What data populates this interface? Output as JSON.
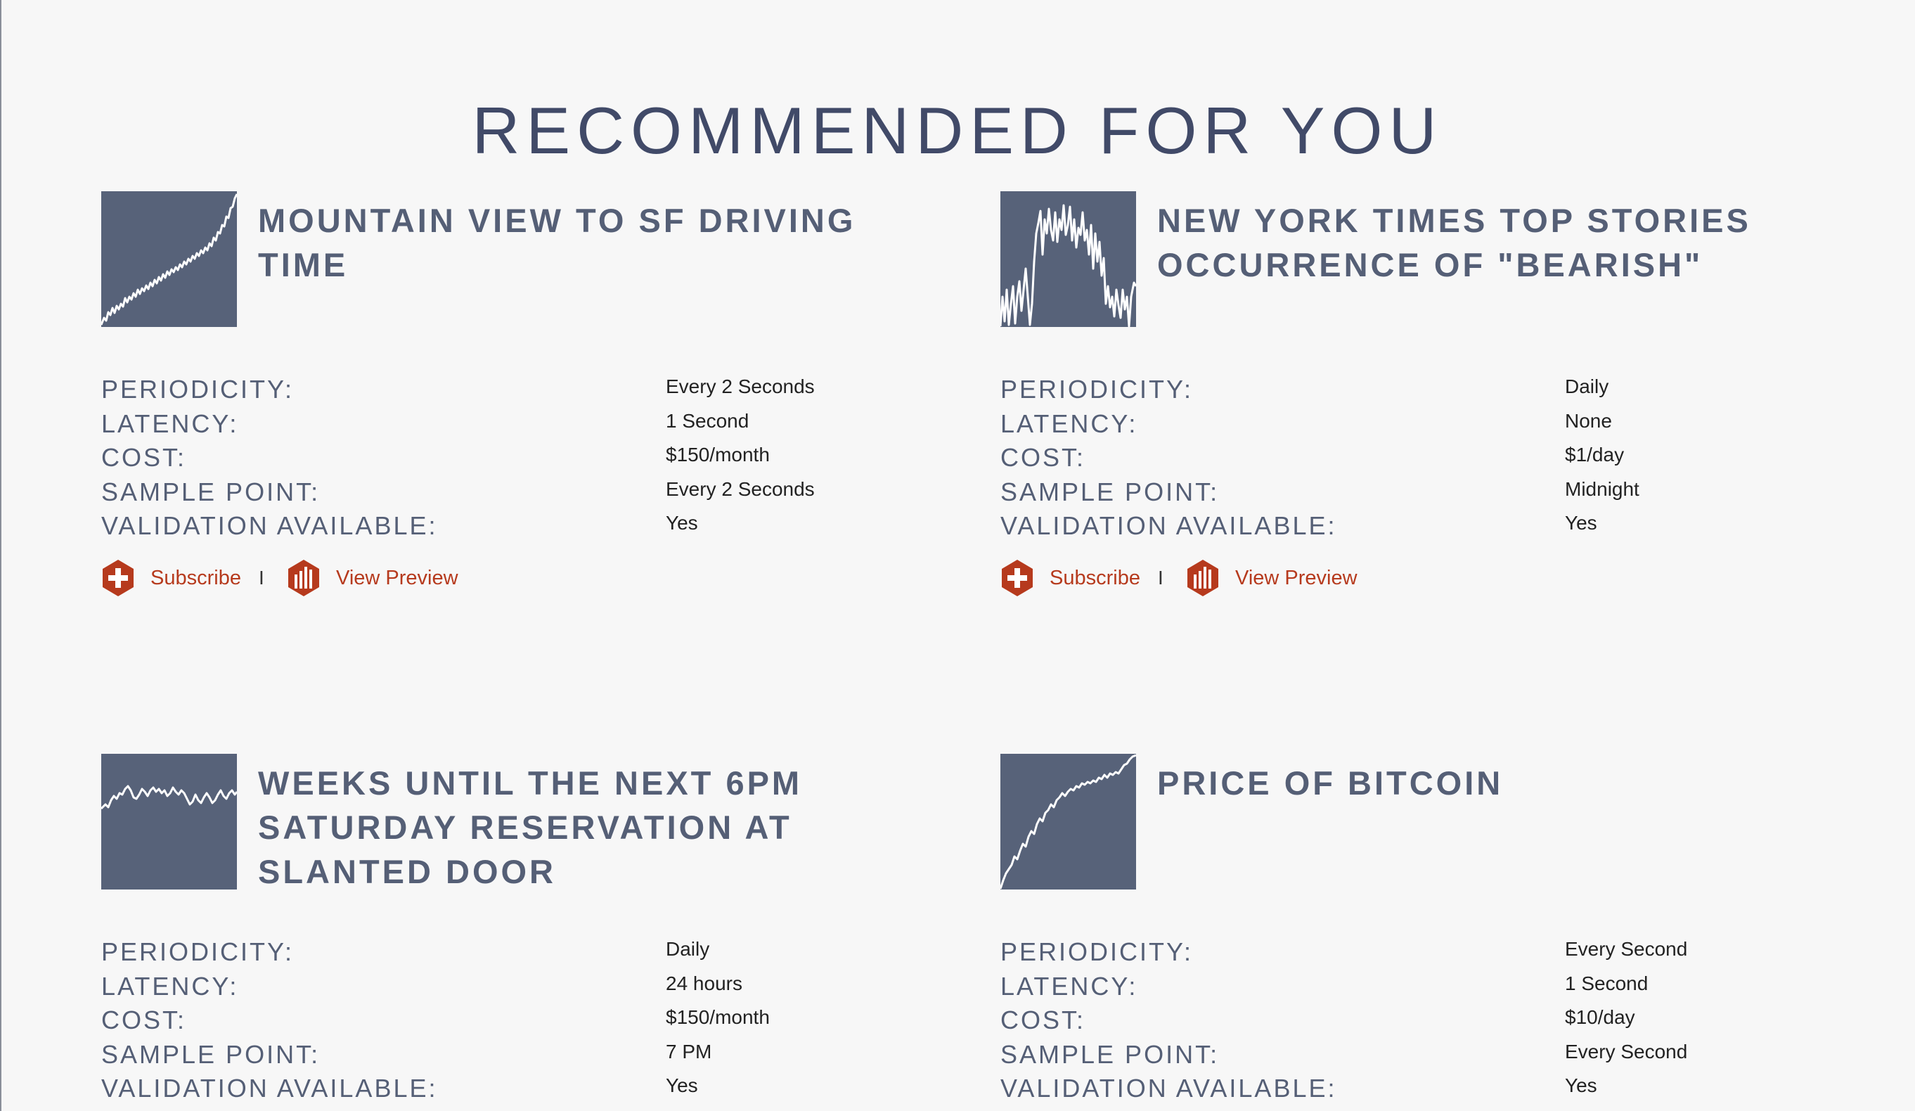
{
  "page": {
    "title": "RECOMMENDED FOR YOU"
  },
  "labels": {
    "periodicity": "PERIODICITY:",
    "latency": "LATENCY:",
    "cost": "COST:",
    "sample_point": "SAMPLE POINT:",
    "validation": "VALIDATION AVAILABLE:",
    "subscribe": "Subscribe",
    "view_preview": "View Preview",
    "separator": "I"
  },
  "cards": [
    {
      "title": "MOUNTAIN VIEW TO SF DRIVING TIME",
      "periodicity": "Every 2 Seconds",
      "latency": "1 Second",
      "cost": "$150/month",
      "sample_point": "Every 2 Seconds",
      "validation": "Yes",
      "sparkline_icon": "sparkline-rising"
    },
    {
      "title": "NEW YORK TIMES TOP STORIES OCCURRENCE OF \"BEARISH\"",
      "periodicity": "Daily",
      "latency": "None",
      "cost": "$1/day",
      "sample_point": "Midnight",
      "validation": "Yes",
      "sparkline_icon": "sparkline-spiky"
    },
    {
      "title": "WEEKS UNTIL THE NEXT 6PM SATURDAY RESERVATION AT SLANTED DOOR",
      "periodicity": "Daily",
      "latency": "24 hours",
      "cost": "$150/month",
      "sample_point": "7 PM",
      "validation": "Yes",
      "sparkline_icon": "sparkline-flat"
    },
    {
      "title": "PRICE OF BITCOIN",
      "periodicity": "Every Second",
      "latency": "1 Second",
      "cost": "$10/day",
      "sample_point": "Every Second",
      "validation": "Yes",
      "sparkline_icon": "sparkline-rising"
    }
  ],
  "colors": {
    "accent": "#b63a1d",
    "thumb_bg": "#576279",
    "heading": "#414a68",
    "text": "#555f76",
    "background": "#f7f7f7"
  }
}
